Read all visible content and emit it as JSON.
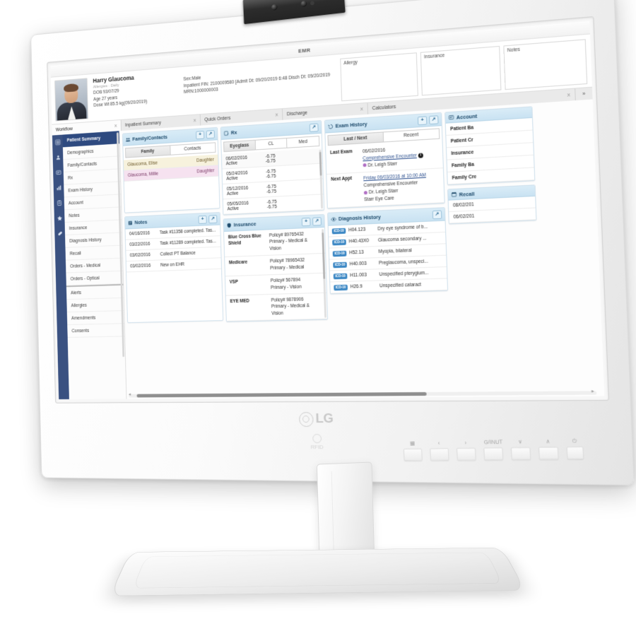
{
  "device": {
    "brand": "LG",
    "rfid_label": "RFID",
    "osd_buttons": [
      {
        "name": "menu-grid",
        "glyph": "▦",
        "label": ""
      },
      {
        "name": "prev",
        "glyph": "‹",
        "label": ""
      },
      {
        "name": "next",
        "glyph": "›",
        "label": ""
      },
      {
        "name": "input",
        "glyph": "",
        "label": "G/INUT"
      },
      {
        "name": "down",
        "glyph": "∨",
        "label": ""
      },
      {
        "name": "up",
        "glyph": "∧",
        "label": ""
      },
      {
        "name": "power",
        "glyph": "⏻",
        "label": ""
      }
    ]
  },
  "app": {
    "title": "EMR",
    "patient": {
      "name": "Harry Glaucoma",
      "alias": "Allergies : Daily",
      "dob": "DOB 93/07/29",
      "age": "Age 27 years",
      "dose_weight": "Dose Wt 85.5 kg(09/20/2019)",
      "sex": "Sex:Male",
      "fin": "Inpatient FIN: 2100009580 [Admit Dt: 09/20/2019 6:48 Disch Dt: 09/20/2019",
      "mrn": "MRN:1000000003"
    },
    "banner_boxes": [
      {
        "label": "Allergy"
      },
      {
        "label": "Insurance"
      },
      {
        "label": "Notes"
      }
    ],
    "tabs": [
      {
        "label": "Workflow",
        "close": "X",
        "active": true
      },
      {
        "label": "Inpatient Summary",
        "close": "X",
        "active": false
      },
      {
        "label": "Quick Orders",
        "close": "X",
        "active": false
      },
      {
        "label": "Discharge",
        "close": "X",
        "active": false
      },
      {
        "label": "Calculators",
        "close": "X",
        "active": false
      }
    ],
    "tab_overflow": "»",
    "icon_rail": [
      "hamburger-menu-icon",
      "person-icon",
      "message-icon",
      "chart-icon",
      "clipboard-icon",
      "star-icon",
      "pill-icon"
    ],
    "nav_items": [
      {
        "label": "Patient Summary",
        "selected": true
      },
      {
        "label": "Demographics",
        "selected": false
      },
      {
        "label": "Family/Contacts",
        "selected": false
      },
      {
        "label": "Rx",
        "selected": false
      },
      {
        "label": "Exam History",
        "selected": false
      },
      {
        "label": "Account",
        "selected": false
      },
      {
        "label": "Notes",
        "selected": false
      },
      {
        "label": "Insurance",
        "selected": false
      },
      {
        "label": "Diagnosis History",
        "selected": false
      },
      {
        "label": "Recall",
        "selected": false
      },
      {
        "label": "Orders - Medical",
        "selected": false
      },
      {
        "label": "Orders - Optical",
        "selected": false
      },
      {
        "label": "Alerts",
        "selected": false,
        "group_start": true
      },
      {
        "label": "Allergies",
        "selected": false
      },
      {
        "label": "Amendments",
        "selected": false
      },
      {
        "label": "Consents",
        "selected": false
      }
    ],
    "cards": {
      "family_contacts": {
        "title": "Family/Contacts",
        "icon": "people-icon",
        "add_label": "+",
        "expand_label": "↗",
        "tabs": [
          {
            "label": "Family",
            "active": true
          },
          {
            "label": "Contacts",
            "active": false
          }
        ],
        "rows": [
          {
            "name": "Glaucoma, Elise",
            "relation": "Daughter",
            "tone": "y"
          },
          {
            "name": "Glaucoma, Millie",
            "relation": "Daughter",
            "tone": "p"
          }
        ]
      },
      "rx": {
        "title": "Rx",
        "icon": "prescription-icon",
        "expand_label": "↗",
        "tabs": [
          {
            "label": "Eyeglass",
            "active": true
          },
          {
            "label": "CL",
            "active": false
          },
          {
            "label": "Med",
            "active": false
          }
        ],
        "rows": [
          {
            "date": "06/02/2016",
            "status": "Active",
            "v1": "-6.75",
            "v2": "-6.75"
          },
          {
            "date": "05/24/2016",
            "status": "Active",
            "v1": "-6.75",
            "v2": "-6.75"
          },
          {
            "date": "05/12/2016",
            "status": "Active",
            "v1": "-6.75",
            "v2": "-6.75"
          },
          {
            "date": "05/05/2016",
            "status": "Active",
            "v1": "-6.75",
            "v2": "-6.75"
          }
        ]
      },
      "exam_history": {
        "title": "Exam History",
        "icon": "history-icon",
        "add_label": "+",
        "expand_label": "↗",
        "tabs": [
          {
            "label": "Last / Next",
            "active": true
          },
          {
            "label": "Recent",
            "active": false
          }
        ],
        "last_exam": {
          "key": "Last Exam",
          "date": "06/02/2016",
          "encounter": "Comprehensive Encounter",
          "provider": "Dr. Leigh Starr"
        },
        "next_appt": {
          "key": "Next Appt",
          "when": "Friday 06/03/2016 at 10:00 AM",
          "encounter": "Comprehensive Encounter",
          "provider": "Dr. Leigh Starr",
          "location": "Starr Eye Care"
        }
      },
      "notes": {
        "title": "Notes",
        "icon": "note-icon",
        "add_label": "+",
        "expand_label": "↗",
        "rows": [
          {
            "date": "04/16/2016",
            "text": "Task #11358 completed. Tas..."
          },
          {
            "date": "03/22/2016",
            "text": "Task #11289 completed. Tas..."
          },
          {
            "date": "03/02/2016",
            "text": "Collect PT Balance"
          },
          {
            "date": "03/02/2016",
            "text": "New on EHR"
          }
        ]
      },
      "insurance": {
        "title": "Insurance",
        "icon": "shield-icon",
        "add_label": "+",
        "expand_label": "↗",
        "rows": [
          {
            "name": "Blue Cross Blue Shield",
            "policy": "Policy# 89765432",
            "detail": "Primary - Medical & Vision"
          },
          {
            "name": "Medicare",
            "policy": "Policy# 78965432",
            "detail": "Primary - Medical"
          },
          {
            "name": "VSP",
            "policy": "Policy# 567894",
            "detail": "Primary - Vision"
          },
          {
            "name": "EYE MED",
            "policy": "Policy# 9878906",
            "detail": "Primary - Medical & Vision"
          }
        ]
      },
      "diagnosis_history": {
        "title": "Diagnosis History",
        "icon": "eye-icon",
        "expand_label": "↗",
        "badge": "ICD-10",
        "rows": [
          {
            "code": "H04.123",
            "desc": "Dry eye syndrome of b..."
          },
          {
            "code": "H40.43X0",
            "desc": "Glaucoma secondary ..."
          },
          {
            "code": "H52.13",
            "desc": "Myopia, bilateral"
          },
          {
            "code": "H40.003",
            "desc": "Preglaucoma, unspeci..."
          },
          {
            "code": "H11.003",
            "desc": "Unspecified pterygium..."
          },
          {
            "code": "H26.9",
            "desc": "Unspecified cataract"
          }
        ]
      },
      "account": {
        "title": "Account",
        "icon": "account-icon",
        "rows": [
          {
            "label": "Patient Ba"
          },
          {
            "label": "Patient Cr"
          },
          {
            "label": "Insurance"
          },
          {
            "label": "Family Ba"
          },
          {
            "label": "Family Cre"
          }
        ]
      },
      "recall": {
        "title": "Recall",
        "icon": "calendar-icon",
        "rows": [
          {
            "date": "08/02/201"
          },
          {
            "date": "06/02/201"
          }
        ]
      }
    }
  }
}
